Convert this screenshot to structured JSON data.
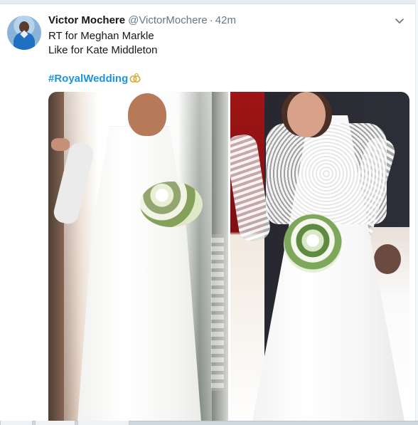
{
  "tweet": {
    "display_name": "Victor Mochere",
    "handle": "@VictorMochere",
    "separator": "·",
    "time": "42m",
    "text_lines": [
      "RT for Meghan Markle",
      "Like for Kate Middleton"
    ],
    "hashtag": "#RoyalWedding"
  },
  "icons": {
    "menu": "chevron-down-icon",
    "hashflag": "wedding-rings-icon",
    "avatar": "profile-avatar"
  },
  "colors": {
    "text": "#14171a",
    "muted": "#657786",
    "link": "#1b95e0"
  }
}
